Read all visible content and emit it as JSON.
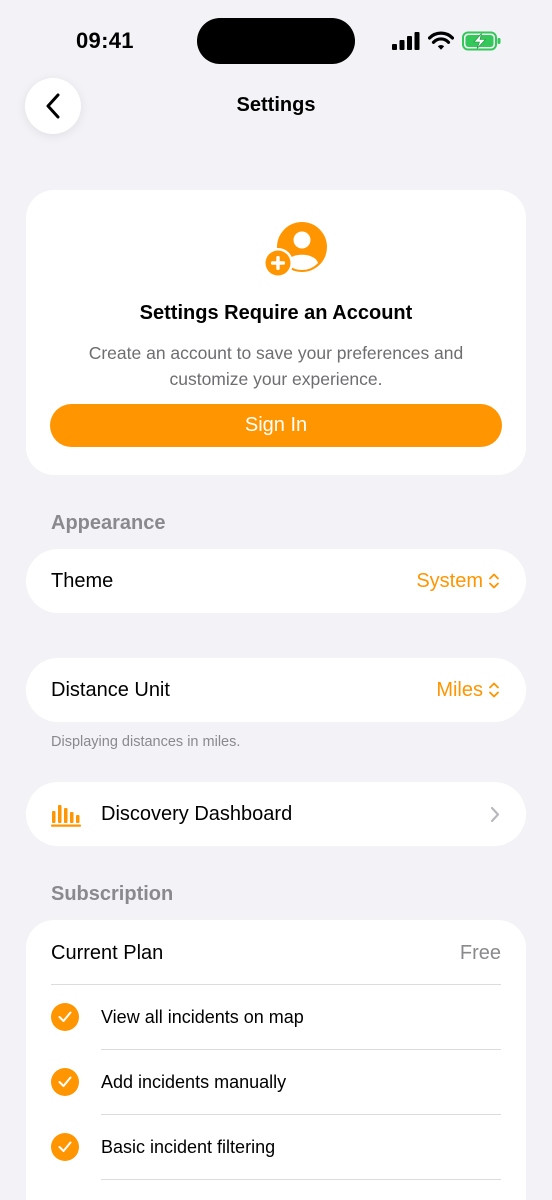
{
  "status_bar": {
    "time": "09:41"
  },
  "nav": {
    "title": "Settings"
  },
  "account_card": {
    "title": "Settings Require an Account",
    "description": "Create an account to save your preferences and customize your experience.",
    "sign_in_label": "Sign In"
  },
  "appearance": {
    "header": "Appearance",
    "theme_label": "Theme",
    "theme_value": "System"
  },
  "distance": {
    "label": "Distance Unit",
    "value": "Miles",
    "footnote": "Displaying distances in miles."
  },
  "dashboard": {
    "label": "Discovery Dashboard"
  },
  "subscription": {
    "header": "Subscription",
    "plan_label": "Current Plan",
    "plan_value": "Free",
    "features": [
      "View all incidents on map",
      "Add incidents manually",
      "Basic incident filtering"
    ]
  },
  "colors": {
    "accent": "#ff9500",
    "background": "#f2f2f7",
    "secondary_text": "#8a8a8e"
  },
  "icons": {
    "back": "chevron-left-icon",
    "account": "add-person-icon",
    "select": "chevron-up-down-icon",
    "dashboard": "bar-chart-icon",
    "disclosure": "chevron-right-icon",
    "feature_check": "checkmark-circle-icon"
  }
}
